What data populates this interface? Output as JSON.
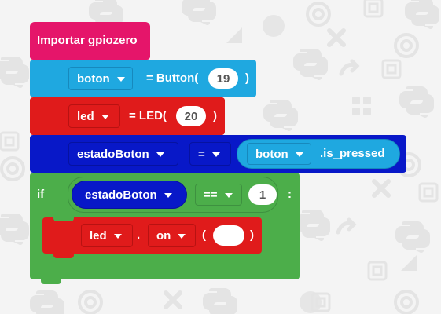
{
  "colors": {
    "import_block": "#e5156a",
    "button_block": "#1fa8e0",
    "led_block": "#e01b1b",
    "estado_block": "#0818c8",
    "if_block": "#4cae4a",
    "background": "#f4f4f4"
  },
  "blocks": {
    "import": {
      "label": "Importar gpiozero"
    },
    "button_assign": {
      "variable": "boton",
      "expression": "= Button(",
      "pin": "19",
      "close": ")"
    },
    "led_assign": {
      "variable": "led",
      "expression": "= LED(",
      "pin": "20",
      "close": ")"
    },
    "estado_assign": {
      "variable": "estadoBoton",
      "operator": "=",
      "object": "boton",
      "property": ".is_pressed"
    },
    "if_block": {
      "keyword": "if",
      "condition_variable": "estadoBoton",
      "comparator": "==",
      "value": "1",
      "colon": ":",
      "body": {
        "object": "led",
        "dot": ".",
        "method": "on",
        "open": "(",
        "argument": "",
        "close": ")"
      }
    }
  },
  "background_icons": [
    "python-logo-icon",
    "puzzle-icon",
    "bullseye-icon",
    "arrow-icon",
    "star-icon",
    "chip-icon",
    "circle-icon",
    "triangle-icon",
    "grid-icon",
    "x-icon",
    "square-icon"
  ]
}
